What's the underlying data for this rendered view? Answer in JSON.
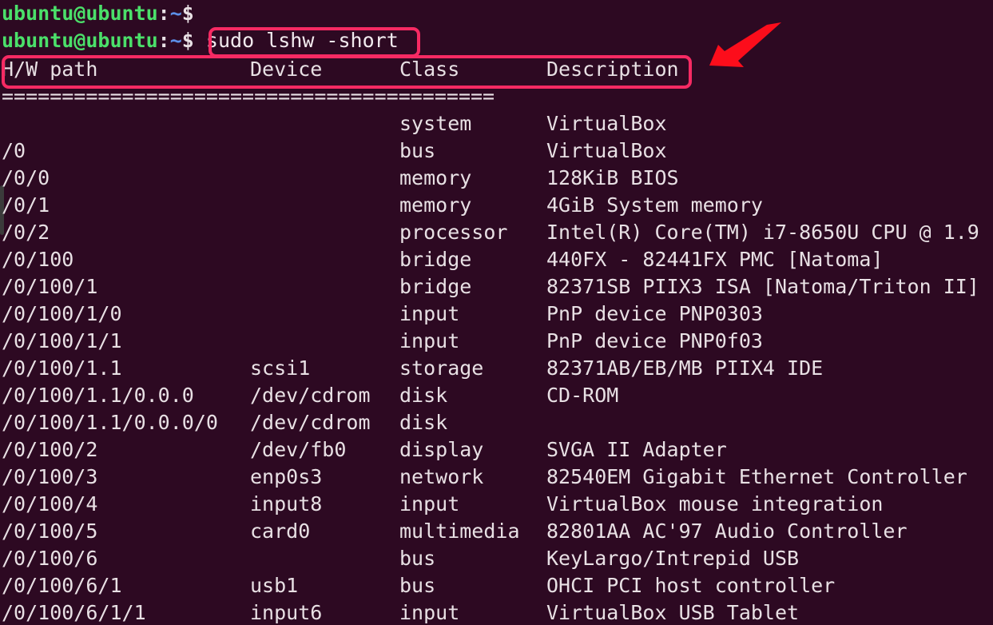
{
  "terminal": {
    "background_color": "#2d0922",
    "foreground_color": "#e8e0e4",
    "prompt": {
      "user_host": "ubuntu@ubuntu",
      "colon": ":",
      "path": "~",
      "dollar": "$"
    },
    "command": "sudo lshw -short",
    "separator": "========================================="
  },
  "annotations": {
    "accent_color": "#f72a63",
    "arrow_color": "#fc0d1b",
    "command_box_label": "sudo lshw -short",
    "header_box_label": "H/W path Device Class Description",
    "arrow_name": "red-arrow-pointing-to-header"
  },
  "table": {
    "headers": {
      "hw_path": "H/W path",
      "device": "Device",
      "class": "Class",
      "description": "Description"
    },
    "rows": [
      {
        "hw_path": "",
        "device": "",
        "class": "system",
        "description": "VirtualBox"
      },
      {
        "hw_path": "/0",
        "device": "",
        "class": "bus",
        "description": "VirtualBox"
      },
      {
        "hw_path": "/0/0",
        "device": "",
        "class": "memory",
        "description": "128KiB BIOS"
      },
      {
        "hw_path": "/0/1",
        "device": "",
        "class": "memory",
        "description": "4GiB System memory"
      },
      {
        "hw_path": "/0/2",
        "device": "",
        "class": "processor",
        "description": "Intel(R) Core(TM) i7-8650U CPU @ 1.9"
      },
      {
        "hw_path": "/0/100",
        "device": "",
        "class": "bridge",
        "description": "440FX - 82441FX PMC [Natoma]"
      },
      {
        "hw_path": "/0/100/1",
        "device": "",
        "class": "bridge",
        "description": "82371SB PIIX3 ISA [Natoma/Triton II]"
      },
      {
        "hw_path": "/0/100/1/0",
        "device": "",
        "class": "input",
        "description": "PnP device PNP0303"
      },
      {
        "hw_path": "/0/100/1/1",
        "device": "",
        "class": "input",
        "description": "PnP device PNP0f03"
      },
      {
        "hw_path": "/0/100/1.1",
        "device": "scsi1",
        "class": "storage",
        "description": "82371AB/EB/MB PIIX4 IDE"
      },
      {
        "hw_path": "/0/100/1.1/0.0.0",
        "device": "/dev/cdrom",
        "class": "disk",
        "description": "CD-ROM"
      },
      {
        "hw_path": "/0/100/1.1/0.0.0/0",
        "device": "/dev/cdrom",
        "class": "disk",
        "description": ""
      },
      {
        "hw_path": "/0/100/2",
        "device": "/dev/fb0",
        "class": "display",
        "description": "SVGA II Adapter"
      },
      {
        "hw_path": "/0/100/3",
        "device": "enp0s3",
        "class": "network",
        "description": "82540EM Gigabit Ethernet Controller"
      },
      {
        "hw_path": "/0/100/4",
        "device": "input8",
        "class": "input",
        "description": "VirtualBox mouse integration"
      },
      {
        "hw_path": "/0/100/5",
        "device": "card0",
        "class": "multimedia",
        "description": "82801AA AC'97 Audio Controller"
      },
      {
        "hw_path": "/0/100/6",
        "device": "",
        "class": "bus",
        "description": "KeyLargo/Intrepid USB"
      },
      {
        "hw_path": "/0/100/6/1",
        "device": "usb1",
        "class": "bus",
        "description": "OHCI PCI host controller"
      },
      {
        "hw_path": "/0/100/6/1/1",
        "device": "input6",
        "class": "input",
        "description": "VirtualBox USB Tablet"
      }
    ]
  }
}
